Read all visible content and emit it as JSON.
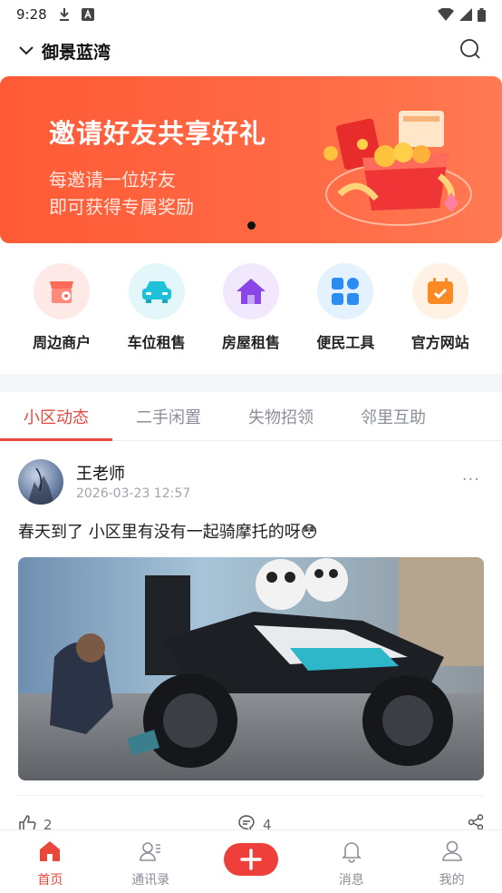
{
  "status_bar": {
    "time": "9:28",
    "icons": [
      "download-icon",
      "a-icon",
      "wifi-icon",
      "signal-icon",
      "battery-icon"
    ]
  },
  "header": {
    "community_name": "御景蓝湾",
    "icons": [
      "chevron-down-icon",
      "search-icon"
    ]
  },
  "banner": {
    "title": "邀请好友共享好礼",
    "line1": "每邀请一位好友",
    "line2": "即可获得专属奖励",
    "colors": {
      "background": "#ff5e3a"
    }
  },
  "quick_links": [
    {
      "label": "周边商户",
      "icon": "shop-icon",
      "bg": "#ffe9e6",
      "color": "#ff6b5a"
    },
    {
      "label": "车位租售",
      "icon": "car-icon",
      "bg": "#e3f7fb",
      "color": "#1fc1d9"
    },
    {
      "label": "房屋租售",
      "icon": "house-icon",
      "bg": "#f1e8fd",
      "color": "#8b46e8"
    },
    {
      "label": "便民工具",
      "icon": "grid-icon",
      "bg": "#e4f1fe",
      "color": "#2b8cf2"
    },
    {
      "label": "官方网站",
      "icon": "calendar-icon",
      "bg": "#fff1e3",
      "color": "#fb8a24"
    }
  ],
  "tabs": [
    {
      "label": "小区动态",
      "active": true
    },
    {
      "label": "二手闲置",
      "active": false
    },
    {
      "label": "失物招领",
      "active": false
    },
    {
      "label": "邻里互助",
      "active": false
    }
  ],
  "post": {
    "author": "王老师",
    "time": "2026-03-23 12:57",
    "more": "···",
    "text": "春天到了 小区里有没有一起骑摩托的呀😳",
    "likes": "2",
    "comments": "4"
  },
  "bottom_nav": [
    {
      "label": "首页",
      "icon": "home-icon",
      "active": true
    },
    {
      "label": "通讯录",
      "icon": "contacts-icon",
      "active": false
    },
    {
      "label": "",
      "icon": "plus-icon",
      "active": false
    },
    {
      "label": "消息",
      "icon": "bell-icon",
      "active": false
    },
    {
      "label": "我的",
      "icon": "user-icon",
      "active": false
    }
  ],
  "colors": {
    "accent": "#e8473c",
    "inactive": "#8a8f99"
  }
}
